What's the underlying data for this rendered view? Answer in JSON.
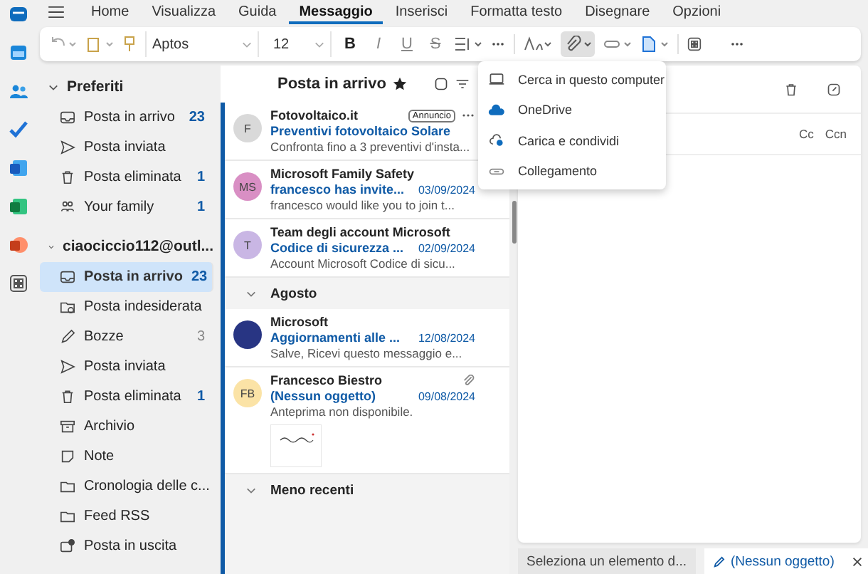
{
  "tabs": [
    {
      "label": "Home",
      "selected": false
    },
    {
      "label": "Visualizza",
      "selected": false
    },
    {
      "label": "Guida",
      "selected": false
    },
    {
      "label": "Messaggio",
      "selected": true
    },
    {
      "label": "Inserisci",
      "selected": false
    },
    {
      "label": "Formatta testo",
      "selected": false
    },
    {
      "label": "Disegnare",
      "selected": false
    },
    {
      "label": "Opzioni",
      "selected": false
    }
  ],
  "ribbon": {
    "font": "Aptos",
    "size": "12",
    "format_buttons": [
      "B",
      "I",
      "U",
      "S"
    ]
  },
  "favorites": {
    "title": "Preferiti",
    "expanded": true,
    "items": [
      {
        "kind": "inbox",
        "label": "Posta in arrivo",
        "count": "23",
        "selected": false
      },
      {
        "kind": "sent",
        "label": "Posta inviata",
        "selected": false
      },
      {
        "kind": "trash",
        "label": "Posta eliminata",
        "count": "1",
        "selected": false
      },
      {
        "kind": "family",
        "label": "Your family",
        "count": "1",
        "selected": false
      }
    ]
  },
  "account": {
    "title": "ciaociccio112@outl...",
    "expanded": true,
    "items": [
      {
        "kind": "inbox",
        "label": "Posta in arrivo",
        "count": "23",
        "selected": true
      },
      {
        "kind": "junk",
        "label": "Posta indesiderata",
        "selected": false
      },
      {
        "kind": "drafts",
        "label": "Bozze",
        "count": "3",
        "selected": false
      },
      {
        "kind": "sent",
        "label": "Posta inviata",
        "selected": false
      },
      {
        "kind": "trash",
        "label": "Posta eliminata",
        "count": "1",
        "selected": false
      },
      {
        "kind": "archive",
        "label": "Archivio",
        "selected": false
      },
      {
        "kind": "notes",
        "label": "Note",
        "selected": false
      },
      {
        "kind": "folder",
        "label": "Cronologia delle c...",
        "selected": false
      },
      {
        "kind": "folder",
        "label": "Feed RSS",
        "selected": false
      },
      {
        "kind": "outbox",
        "label": "Posta in uscita",
        "selected": false
      }
    ]
  },
  "message_list": {
    "title": "Posta in arrivo",
    "groups": [
      {
        "messages": [
          {
            "sender": "Fotovoltaico.it",
            "subject": "Preventivi fotovoltaico Solare",
            "preview": "Confronta fino a 3 preventivi d'insta...",
            "initials": "F",
            "color": "#d9d9d9",
            "badge": "Annuncio"
          },
          {
            "sender": "Microsoft Family Safety",
            "subject": "francesco has invite...",
            "date": "03/09/2024",
            "preview": "francesco would like you to join t...",
            "initials": "MS",
            "color": "#d98fc4"
          },
          {
            "sender": "Team degli account Microsoft",
            "subject": "Codice di sicurezza ...",
            "date": "02/09/2024",
            "preview": "Account Microsoft Codice di sicu...",
            "initials": "T",
            "color": "#c9b6e4"
          }
        ]
      },
      {
        "title": "Agosto",
        "expanded": true,
        "messages": [
          {
            "sender": "Microsoft",
            "subject": "Aggiornamenti alle ...",
            "date": "12/08/2024",
            "preview": "Salve, Ricevi questo messaggio e...",
            "color": "#283583"
          },
          {
            "sender": "Francesco Biestro",
            "subject": "(Nessun oggetto)",
            "date": "09/08/2024",
            "preview": "Anteprima non disponibile.",
            "initials": "FB",
            "color": "#fbe3a6",
            "attachment": true,
            "thumbnail": true
          }
        ]
      },
      {
        "title": "Meno recenti",
        "expanded": true
      }
    ]
  },
  "compose": {
    "cc": "Cc",
    "bcc": "Ccn"
  },
  "bottom_tabs": [
    {
      "label": "Seleziona un elemento d...",
      "selected": false,
      "kind": "plain"
    },
    {
      "label": "(Nessun oggetto)",
      "selected": true,
      "kind": "draft"
    }
  ],
  "attach_menu": {
    "open": true,
    "items": [
      {
        "kind": "computer",
        "label": "Cerca in questo computer"
      },
      {
        "kind": "cloud",
        "label": "OneDrive"
      },
      {
        "kind": "upload",
        "label": "Carica e condividi"
      },
      {
        "kind": "link",
        "label": "Collegamento"
      }
    ]
  }
}
